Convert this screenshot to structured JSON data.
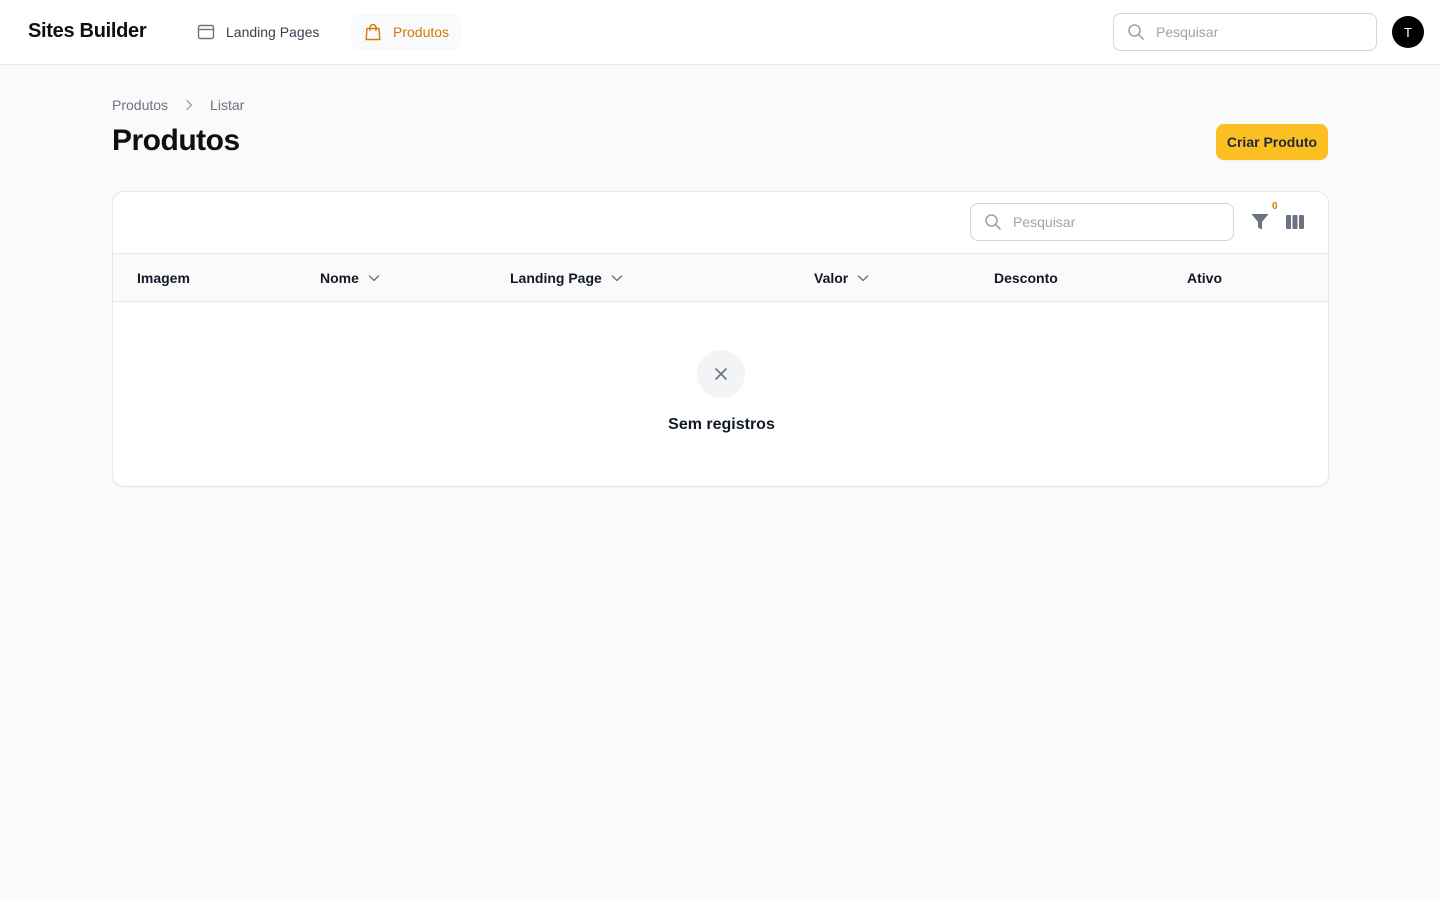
{
  "app": {
    "brand": "Sites Builder"
  },
  "nav": {
    "items": [
      {
        "label": "Landing Pages",
        "icon": "window-icon",
        "active": false
      },
      {
        "label": "Produtos",
        "icon": "shopping-bag-icon",
        "active": true
      }
    ]
  },
  "global_search": {
    "placeholder": "Pesquisar",
    "value": ""
  },
  "user": {
    "avatar_initial": "T"
  },
  "breadcrumb": {
    "items": [
      "Produtos",
      "Listar"
    ]
  },
  "page": {
    "title": "Produtos",
    "create_button_label": "Criar Produto"
  },
  "table": {
    "search": {
      "placeholder": "Pesquisar",
      "value": ""
    },
    "filter_count": "0",
    "columns": [
      {
        "label": "Imagem",
        "sortable": false
      },
      {
        "label": "Nome",
        "sortable": true
      },
      {
        "label": "Landing Page",
        "sortable": true
      },
      {
        "label": "Valor",
        "sortable": true
      },
      {
        "label": "Desconto",
        "sortable": false
      },
      {
        "label": "Ativo",
        "sortable": false
      }
    ],
    "empty_message": "Sem registros"
  },
  "colors": {
    "accent": "#fbbf24",
    "active_nav_text": "#d97706",
    "background": "#fafafa"
  }
}
